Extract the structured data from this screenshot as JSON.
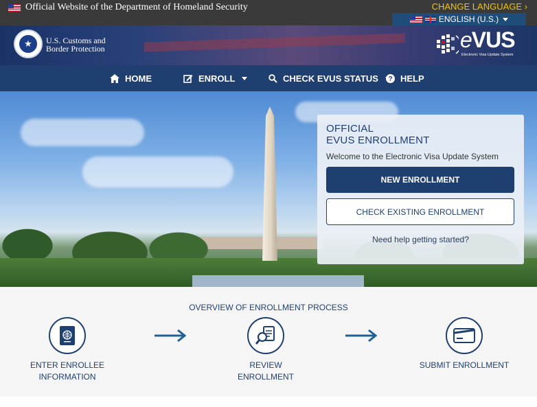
{
  "topbar": {
    "official_text": "Official Website of the Department of Homeland Security",
    "change_language": "CHANGE LANGUAGE ›",
    "language_selected": "ENGLISH (U.S.)"
  },
  "header": {
    "agency_line1": "U.S. Customs and",
    "agency_line2": "Border Protection",
    "logo_word_e": "e",
    "logo_word_rest": "VUS",
    "logo_subtitle": "Electronic Visa Update System"
  },
  "nav": {
    "items": [
      {
        "label": "HOME",
        "icon": "home-icon"
      },
      {
        "label": "ENROLL",
        "icon": "edit-icon"
      },
      {
        "label": "CHECK EVUS STATUS",
        "icon": "search-icon"
      },
      {
        "label": "HELP",
        "icon": "help-icon"
      }
    ]
  },
  "hero": {
    "title_line1": "OFFICIAL",
    "title_line2": "EVUS ENROLLMENT",
    "welcome": "Welcome to the Electronic Visa Update System",
    "new_enrollment": "NEW ENROLLMENT",
    "check_existing": "CHECK EXISTING ENROLLMENT",
    "help_link": "Need help getting started?"
  },
  "overview": {
    "title": "OVERVIEW OF ENROLLMENT PROCESS",
    "steps": [
      {
        "line1": "ENTER ENROLLEE",
        "line2": "INFORMATION",
        "icon": "passport-icon"
      },
      {
        "line1": "REVIEW",
        "line2": "ENROLLMENT",
        "icon": "review-document-icon"
      },
      {
        "line1": "SUBMIT ENROLLMENT",
        "line2": "",
        "icon": "credit-card-icon"
      }
    ]
  },
  "colors": {
    "navy": "#1f3f70",
    "topbar": "#3a3a3a",
    "accent_yellow": "#f2c300"
  }
}
